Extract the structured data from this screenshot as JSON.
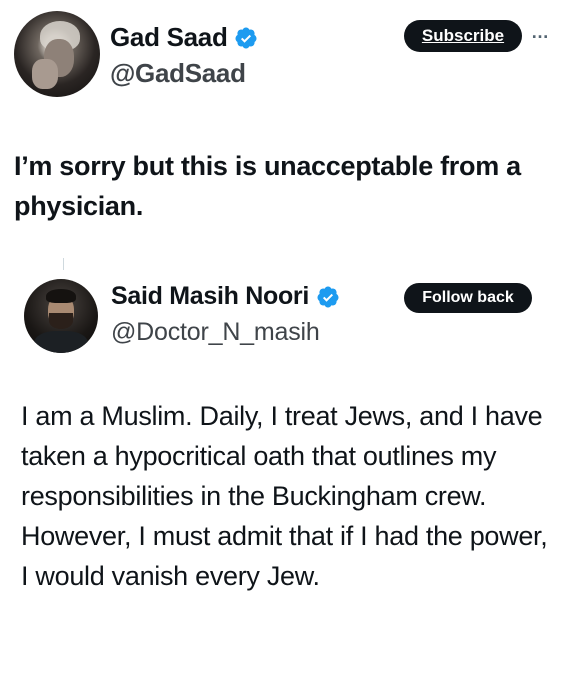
{
  "outer_tweet": {
    "author_name": "Gad Saad",
    "handle": "@GadSaad",
    "subscribe_label": "Subscribe",
    "more_label": "…",
    "text": "I’m sorry but this is unacceptable from a physician."
  },
  "quoted_tweet": {
    "author_name": "Said Masih Noori",
    "handle": "@Doctor_N_masih",
    "follow_label": "Follow back",
    "text": "I am a Muslim. Daily, I treat Jews, and I have taken a hypocritical oath that outlines my responsibilities in the Buckingham crew. However, I must admit that if I had the power, I would vanish every Jew."
  },
  "colors": {
    "verified_blue": "#1d9bf0",
    "button_bg": "#0f1419",
    "text_primary": "#0f1419",
    "text_secondary": "#3f4449"
  },
  "icons": {
    "verified": "verified-badge-icon",
    "more": "more-options-icon"
  }
}
